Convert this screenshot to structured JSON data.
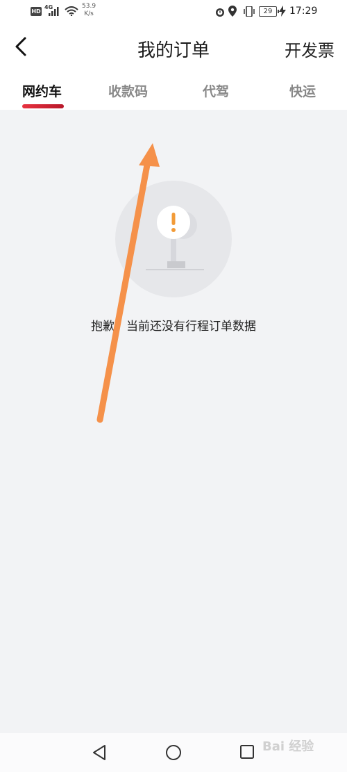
{
  "status_bar": {
    "hd": "HD",
    "network": "4G",
    "speed_value": "53.9",
    "speed_unit": "K/s",
    "battery": "29",
    "time": "17:29"
  },
  "header": {
    "title": "我的订单",
    "action": "开发票"
  },
  "tabs": [
    {
      "label": "网约车",
      "active": true
    },
    {
      "label": "收款码",
      "active": false
    },
    {
      "label": "代驾",
      "active": false
    },
    {
      "label": "快运",
      "active": false
    }
  ],
  "empty_state": {
    "message": "抱歉，当前还没有行程订单数据"
  },
  "watermark": "Bai 经验",
  "colors": {
    "accent": "#d42a37",
    "annotation_arrow": "#f5914a",
    "alert_icon": "#f29b38"
  }
}
